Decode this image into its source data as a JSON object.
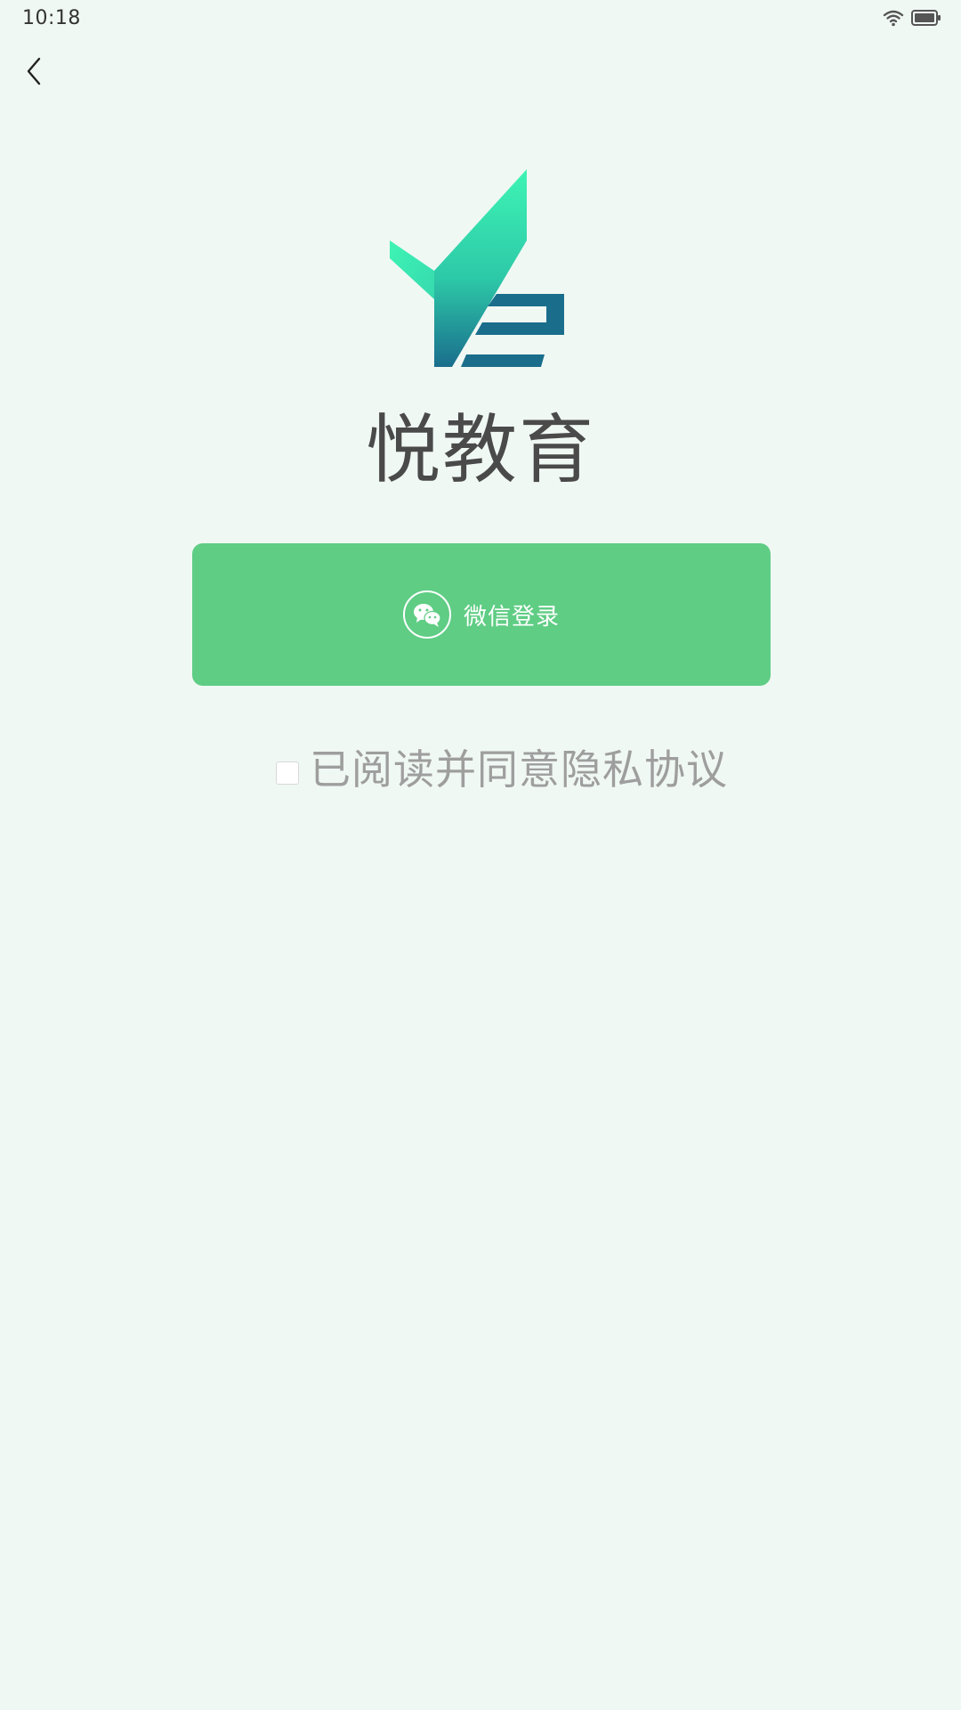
{
  "status_bar": {
    "time": "10:18",
    "icons": [
      "wifi-icon",
      "battery-icon"
    ]
  },
  "navigation": {
    "back_icon": "chevron-left-icon"
  },
  "brand": {
    "logo_icon": "yue-education-logo-icon",
    "app_name": "悦教育"
  },
  "login": {
    "wechat_icon": "wechat-icon",
    "wechat_label": "微信登录",
    "button_color": "#5fcd84"
  },
  "agreement": {
    "checked": false,
    "text": "已阅读并同意隐私协议"
  },
  "colors": {
    "background": "#f0f8f4",
    "logo_green": "#3ef0b0",
    "logo_teal": "#1a6e8c",
    "text_gray": "#9e9e9e"
  }
}
